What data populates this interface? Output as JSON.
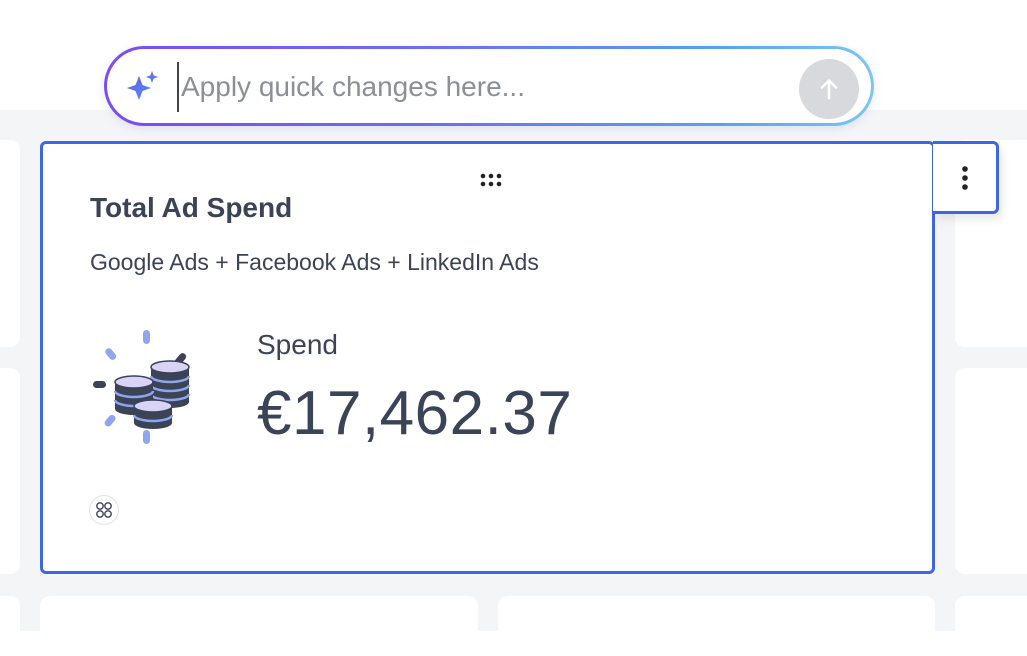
{
  "quick_bar": {
    "placeholder": "Apply quick changes here...",
    "value": "",
    "icon": "sparkle-icon",
    "send_icon": "arrow-up-icon"
  },
  "widget": {
    "title": "Total Ad Spend",
    "subtitle": "Google Ads + Facebook Ads + LinkedIn Ads",
    "metric_label": "Spend",
    "metric_value": "€17,462.37",
    "illustration": "coins-icon",
    "drag_icon": "drag-handle-icon",
    "badge_icon": "integrations-icon",
    "menu_icon": "more-vertical-icon"
  },
  "colors": {
    "accent_border": "#3f66dc",
    "text": "#3b4357",
    "gradient_start": "#7b4df0",
    "gradient_end": "#7cc6f2",
    "send_button_bg": "#d7d9dd"
  }
}
